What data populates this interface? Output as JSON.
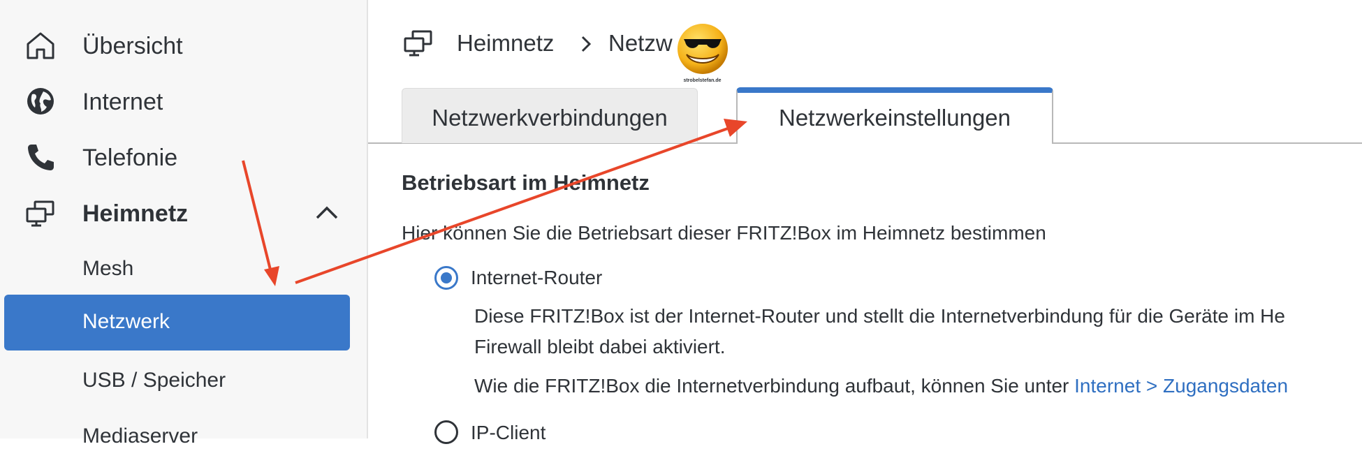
{
  "sidebar": {
    "items": [
      {
        "label": "Übersicht",
        "icon": "home-icon"
      },
      {
        "label": "Internet",
        "icon": "globe-icon"
      },
      {
        "label": "Telefonie",
        "icon": "phone-icon"
      },
      {
        "label": "Heimnetz",
        "icon": "network-icon",
        "expanded": true
      }
    ],
    "subitems": [
      {
        "label": "Mesh",
        "active": false
      },
      {
        "label": "Netzwerk",
        "active": true
      },
      {
        "label": "USB / Speicher",
        "active": false
      },
      {
        "label": "Mediaserver",
        "active": false
      }
    ],
    "active_color": "#3a78c9"
  },
  "breadcrumb": {
    "icon": "network-icon",
    "root": "Heimnetz",
    "separator_icon": "chevron-right-icon",
    "current": "Netzw"
  },
  "tabs": [
    {
      "label": "Netzwerkverbindungen",
      "active": false
    },
    {
      "label": "Netzwerkeinstellungen",
      "active": true
    }
  ],
  "content": {
    "section_title": "Betriebsart im Heimnetz",
    "intro": "Hier können Sie die Betriebsart dieser FRITZ!Box im Heimnetz bestimmen",
    "options": [
      {
        "label": "Internet-Router",
        "selected": true,
        "desc_line1": "Diese FRITZ!Box ist der Internet-Router und stellt die Internetverbindung für die Geräte im He",
        "desc_line2": "Firewall bleibt dabei aktiviert.",
        "desc_line3_prefix": "Wie die FRITZ!Box die Internetverbindung aufbaut, können Sie unter ",
        "desc_link": "Internet > Zugangsdaten"
      },
      {
        "label": "IP-Client",
        "selected": false
      }
    ]
  },
  "annotation": {
    "arrow_color": "#e8462a"
  },
  "watermark": {
    "text": "strobelstefan.de",
    "icon": "sunglasses-smiley-icon"
  }
}
